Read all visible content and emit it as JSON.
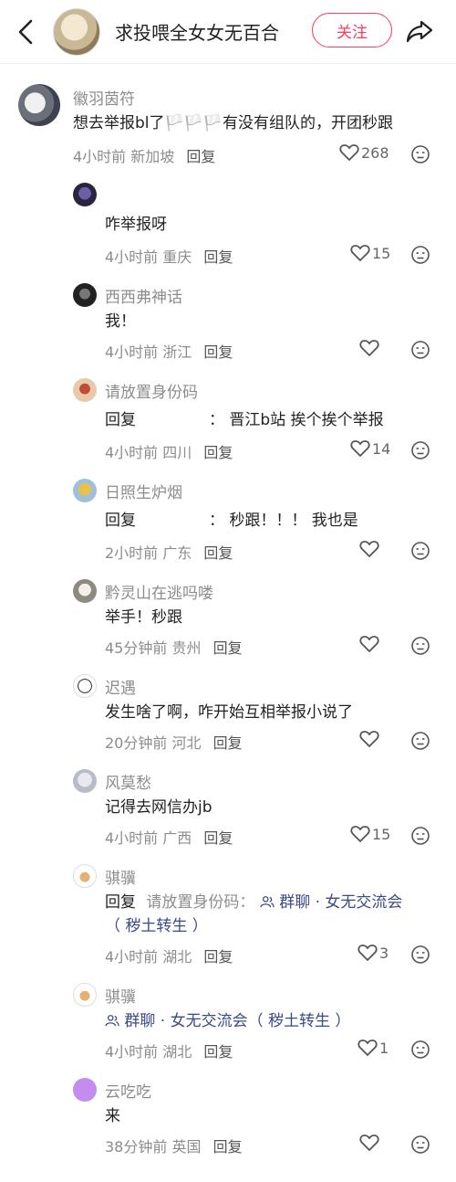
{
  "header": {
    "title": "求投喂全女女无百合",
    "follow_label": "关注"
  },
  "comments": [
    {
      "name": "徽羽茵符",
      "text": "想去举报bl了🏳️🏳️🏳️有没有组队的，开团秒跟",
      "time": "4小时前",
      "location": "新加坡",
      "reply_label": "回复",
      "likes": "268"
    }
  ],
  "replies": [
    {
      "name": "",
      "text": "咋举报呀",
      "time": "4小时前",
      "location": "重庆",
      "reply_label": "回复",
      "likes": "15"
    },
    {
      "name": "西西弗神话",
      "text": "我！",
      "time": "4小时前",
      "location": "浙江",
      "reply_label": "回复",
      "likes": ""
    },
    {
      "name": "请放置身份码",
      "prefix": "回复",
      "text": "：  晋江b站 挨个挨个举报",
      "time": "4小时前",
      "location": "四川",
      "reply_label": "回复",
      "likes": "14"
    },
    {
      "name": "日照生炉烟",
      "prefix": "回复",
      "text": "：  秒跟！！！ 我也是",
      "time": "2小时前",
      "location": "广东",
      "reply_label": "回复",
      "likes": ""
    },
    {
      "name": "黔灵山在逃吗喽",
      "text": "举手！秒跟",
      "time": "45分钟前",
      "location": "贵州",
      "reply_label": "回复",
      "likes": ""
    },
    {
      "name": "迟遇",
      "text": "发生啥了啊，咋开始互相举报小说了",
      "time": "20分钟前",
      "location": "河北",
      "reply_label": "回复",
      "likes": ""
    },
    {
      "name": "风莫愁",
      "text": "记得去网信办jb",
      "time": "4小时前",
      "location": "广西",
      "reply_label": "回复",
      "likes": "15"
    },
    {
      "name": "骐骥",
      "prefix": "回复",
      "reply_to": "请放置身份码：",
      "group_label": "群聊 · 女无交流会",
      "text_line2": "（ 秽土转生 ）",
      "time": "4小时前",
      "location": "湖北",
      "reply_label": "回复",
      "likes": "3"
    },
    {
      "name": "骐骥",
      "group_label": "群聊 · 女无交流会（ 秽土转生 ）",
      "time": "4小时前",
      "location": "湖北",
      "reply_label": "回复",
      "likes": "1"
    },
    {
      "name": "云吃吃",
      "text": "来",
      "time": "38分钟前",
      "location": "英国",
      "reply_label": "回复",
      "likes": ""
    }
  ],
  "colors": {
    "accent": "#ff3b5c",
    "group_link": "#3a4a8a"
  },
  "icons": [
    "back-arrow-icon",
    "share-icon",
    "heart-icon",
    "dislike-face-icon",
    "group-people-icon"
  ]
}
